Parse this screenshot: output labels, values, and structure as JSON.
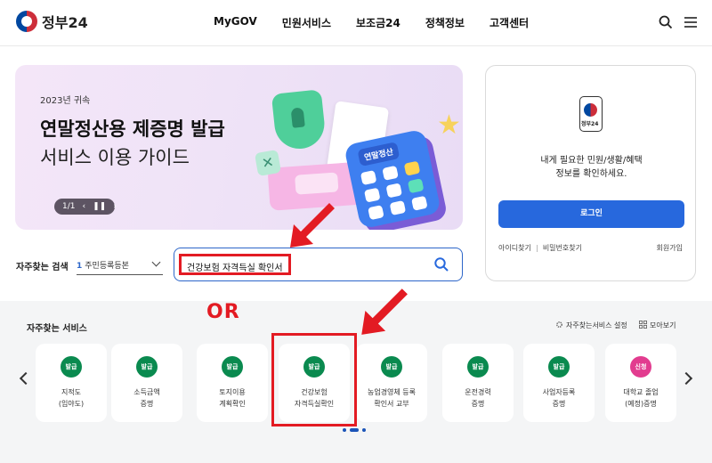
{
  "header": {
    "logo_text": "정부24",
    "nav": [
      "MyGOV",
      "민원서비스",
      "보조금24",
      "정책정보",
      "고객센터"
    ]
  },
  "banner": {
    "year": "2023년 귀속",
    "title": "연말정산용 제증명 발급",
    "subtitle": "서비스 이용 가이드",
    "pager": "1/1",
    "art_label": "연말정산"
  },
  "search": {
    "label": "자주찾는 검색",
    "select_num": "1",
    "select_text": "주민등록등본",
    "value": "건강보험 자격득실 확인서"
  },
  "login": {
    "phone_label": "정부24",
    "message_line1": "내게 필요한 민원/생활/혜택",
    "message_line2": "정보를 확인하세요.",
    "login_button": "로그인",
    "find_id": "아이디찾기",
    "find_pw": "비밀번호찾기",
    "join": "회원가입"
  },
  "annotation": {
    "or_text": "OR"
  },
  "services": {
    "title": "자주찾는 서비스",
    "settings": "자주찾는서비스 설정",
    "view_all": "모아보기",
    "items": [
      {
        "badge": "발급",
        "line1": "지적도",
        "line2": "(임야도)",
        "color": "#0a8a4f"
      },
      {
        "badge": "발급",
        "line1": "소득금액",
        "line2": "증명",
        "color": "#0a8a4f"
      },
      {
        "badge": "발급",
        "line1": "토지이용",
        "line2": "계획확인",
        "color": "#0a8a4f"
      },
      {
        "badge": "발급",
        "line1": "건강보험",
        "line2": "자격득실확인",
        "color": "#0a8a4f"
      },
      {
        "badge": "발급",
        "line1": "농업경영체 등록",
        "line2": "확인서 교부",
        "color": "#0a8a4f"
      },
      {
        "badge": "발급",
        "line1": "운전경력",
        "line2": "증명",
        "color": "#0a8a4f"
      },
      {
        "badge": "발급",
        "line1": "사업자등록",
        "line2": "증명",
        "color": "#0a8a4f"
      },
      {
        "badge": "신청",
        "line1": "대학교 졸업",
        "line2": "(예정)증명",
        "color": "#e23c8f"
      }
    ]
  },
  "colors": {
    "accent": "#2768dd",
    "badge_issue": "#0a8a4f",
    "badge_apply": "#e23c8f",
    "annotation": "#e31b23"
  }
}
